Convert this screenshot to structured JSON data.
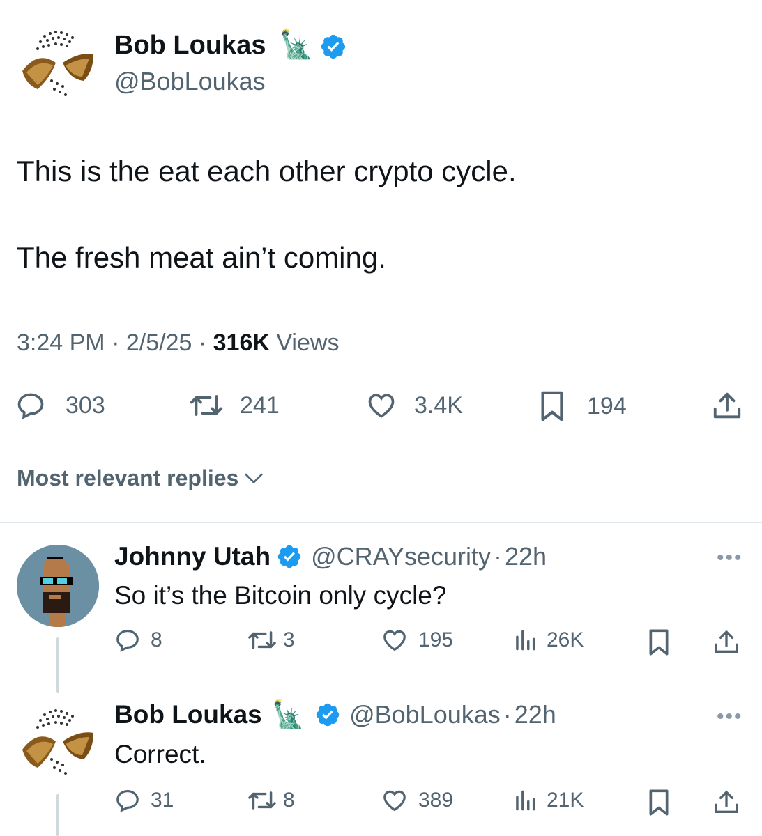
{
  "main_tweet": {
    "author_name": "Bob Loukas",
    "author_handle": "@BobLoukas",
    "author_emoji": "🗽",
    "text_line1": "This is the eat each other crypto cycle.",
    "text_line2": "The fresh meat ain’t coming.",
    "time": "3:24 PM",
    "date": "2/5/25",
    "views_count": "316K",
    "views_label": "Views",
    "sep": "·",
    "stats": {
      "replies": "303",
      "reposts": "241",
      "likes": "3.4K",
      "bookmarks": "194"
    }
  },
  "replies_sort_label": "Most relevant replies",
  "replies": [
    {
      "author_name": "Johnny Utah",
      "author_handle": "@CRAYsecurity",
      "sep": "·",
      "time": "22h",
      "text": "So it’s the Bitcoin only cycle?",
      "stats": {
        "replies": "8",
        "reposts": "3",
        "likes": "195",
        "views": "26K"
      }
    },
    {
      "author_name": "Bob Loukas",
      "author_emoji": "🗽",
      "author_handle": "@BobLoukas",
      "sep": "·",
      "time": "22h",
      "text": "Correct.",
      "stats": {
        "replies": "31",
        "reposts": "8",
        "likes": "389",
        "views": "21K"
      }
    }
  ],
  "more_glyph": "•••",
  "colors": {
    "verified": "#1d9bf0",
    "muted": "#536471",
    "text": "#0f1419",
    "divider": "#e1e8ed"
  }
}
